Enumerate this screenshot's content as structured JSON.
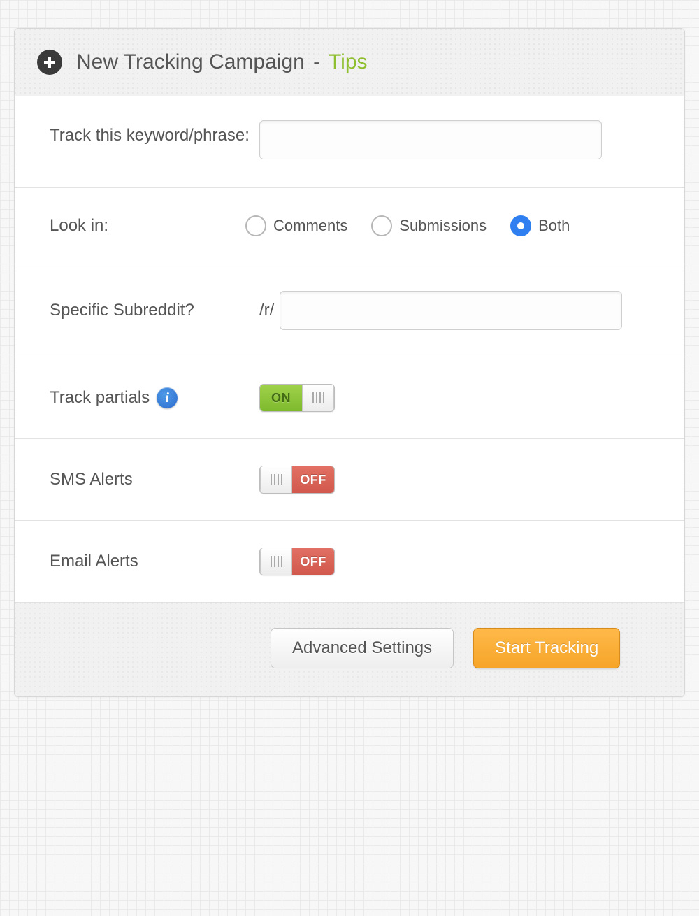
{
  "header": {
    "title": "New Tracking Campaign",
    "separator": "-",
    "tips_label": "Tips"
  },
  "form": {
    "keyword": {
      "label": "Track this keyword/phrase:",
      "value": ""
    },
    "look_in": {
      "label": "Look in:",
      "options": [
        {
          "label": "Comments",
          "value": "comments",
          "selected": false
        },
        {
          "label": "Submissions",
          "value": "submissions",
          "selected": false
        },
        {
          "label": "Both",
          "value": "both",
          "selected": true
        }
      ]
    },
    "subreddit": {
      "label": "Specific Subreddit?",
      "prefix": "/r/",
      "value": ""
    },
    "track_partials": {
      "label": "Track partials",
      "on_label": "ON",
      "off_label": "OFF",
      "value": true
    },
    "sms_alerts": {
      "label": "SMS Alerts",
      "on_label": "ON",
      "off_label": "OFF",
      "value": false
    },
    "email_alerts": {
      "label": "Email Alerts",
      "on_label": "ON",
      "off_label": "OFF",
      "value": false
    }
  },
  "footer": {
    "advanced_label": "Advanced Settings",
    "start_label": "Start Tracking"
  }
}
